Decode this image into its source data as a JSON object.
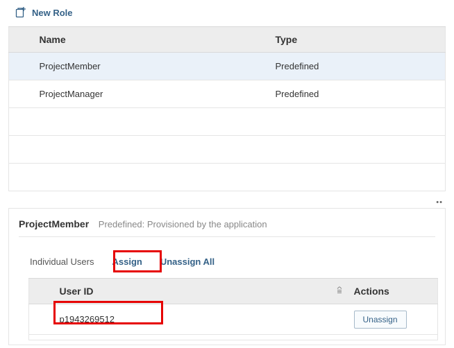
{
  "new_role": {
    "label": "New Role"
  },
  "roles_table": {
    "headers": {
      "name": "Name",
      "type": "Type"
    },
    "rows": [
      {
        "name": "ProjectMember",
        "type": "Predefined",
        "selected": true
      },
      {
        "name": "ProjectManager",
        "type": "Predefined",
        "selected": false
      }
    ]
  },
  "detail": {
    "title": "ProjectMember",
    "subtitle": "Predefined: Provisioned by the application",
    "tab_label": "Individual Users",
    "assign_label": "Assign",
    "unassign_all_label": "Unassign All",
    "users_table": {
      "headers": {
        "user_id": "User ID",
        "actions": "Actions"
      },
      "rows": [
        {
          "user_id": "p1943269512",
          "action_label": "Unassign"
        }
      ]
    }
  },
  "dots": "••"
}
